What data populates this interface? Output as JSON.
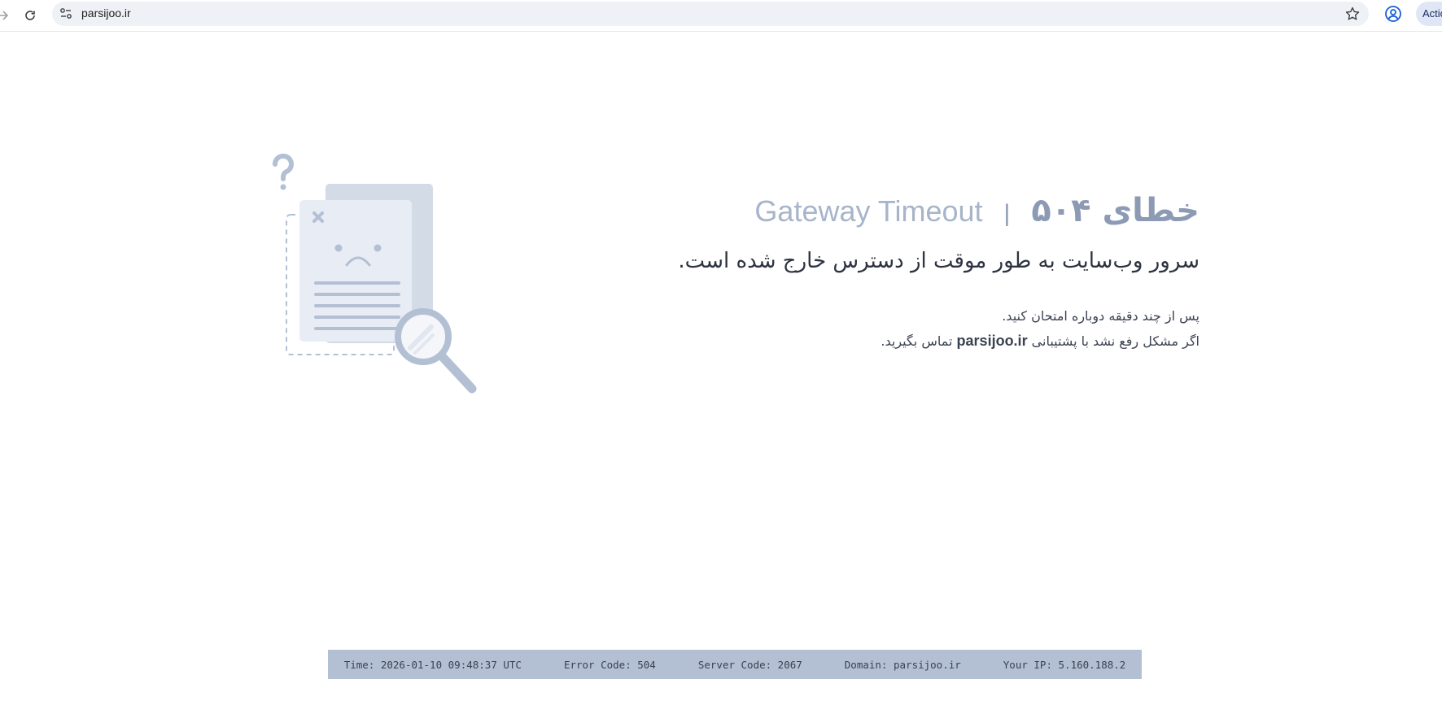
{
  "browser": {
    "url": "parsijoo.ir",
    "actions_label": "Actio"
  },
  "error": {
    "title_fa": "خطای ۵۰۴",
    "separator": "|",
    "title_en": "Gateway Timeout",
    "subtitle": "سرور وب‌سایت به طور موقت از دسترس خارج شده است.",
    "hint_line1": "پس از چند دقیقه دوباره امتحان کنید.",
    "hint_line2_before": "اگر مشکل رفع نشد با پشتیبانی ",
    "hint_line2_brand": "parsijoo.ir",
    "hint_line2_after": " تماس بگیرید."
  },
  "infobar": {
    "time": "Time: 2026-01-10 09:48:37 UTC",
    "error_code": "Error Code: 504",
    "server_code": "Server Code: 2067",
    "domain": "Domain: parsijoo.ir",
    "ip": "Your IP: 5.160.188.2"
  },
  "colors": {
    "illustration_main": "#b3c0d4",
    "illustration_light": "#e8ecf4",
    "illustration_back": "#d3dbe7",
    "infobar_bg": "#b3c0d4"
  },
  "icons": {
    "forward": "forward-arrow-icon",
    "reload": "reload-icon",
    "site_settings": "tune-icon",
    "bookmark": "star-icon",
    "profile": "profile-icon"
  }
}
